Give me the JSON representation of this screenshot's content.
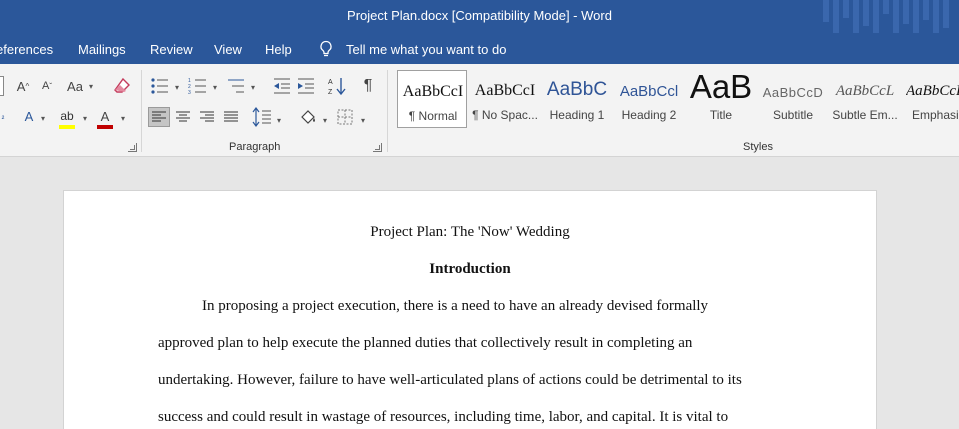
{
  "window": {
    "title": "Project Plan.docx [Compatibility Mode]  -  Word"
  },
  "menu": {
    "items": [
      "eferences",
      "Mailings",
      "Review",
      "View",
      "Help"
    ],
    "tell_me": "Tell me what you want to do"
  },
  "ribbon": {
    "font_group": {
      "grow_label": "A",
      "shrink_label": "A",
      "case_label": "Aa",
      "effects_label": "A",
      "font_color_label": "A"
    },
    "paragraph_label": "Paragraph",
    "styles_label": "Styles",
    "styles": [
      {
        "sample": "AaBbCcI",
        "name": "¶ Normal"
      },
      {
        "sample": "AaBbCcI",
        "name": "¶ No Spac..."
      },
      {
        "sample": "AaBbC",
        "name": "Heading 1"
      },
      {
        "sample": "AaBbCcl",
        "name": "Heading 2"
      },
      {
        "sample": "AaB",
        "name": "Title"
      },
      {
        "sample": "AaBbCcD",
        "name": "Subtitle"
      },
      {
        "sample": "AaBbCcL",
        "name": "Subtle Em..."
      },
      {
        "sample": "AaBbCcL",
        "name": "Emphasis"
      }
    ],
    "colors": {
      "highlight": "#ffff00",
      "font_color": "#c00000"
    }
  },
  "document": {
    "title": "Project Plan: The 'Now' Wedding",
    "heading": "Introduction",
    "lines": [
      "In proposing a project execution, there is a need to have an already devised formally",
      "approved plan to help execute the planned duties that collectively result in completing an",
      "undertaking. However, failure to have well-articulated plans of actions could be detrimental to its",
      "success and could result in wastage of resources, including time, labor, and capital. It is vital to"
    ]
  },
  "theme": {
    "accent": "#2b579a"
  }
}
